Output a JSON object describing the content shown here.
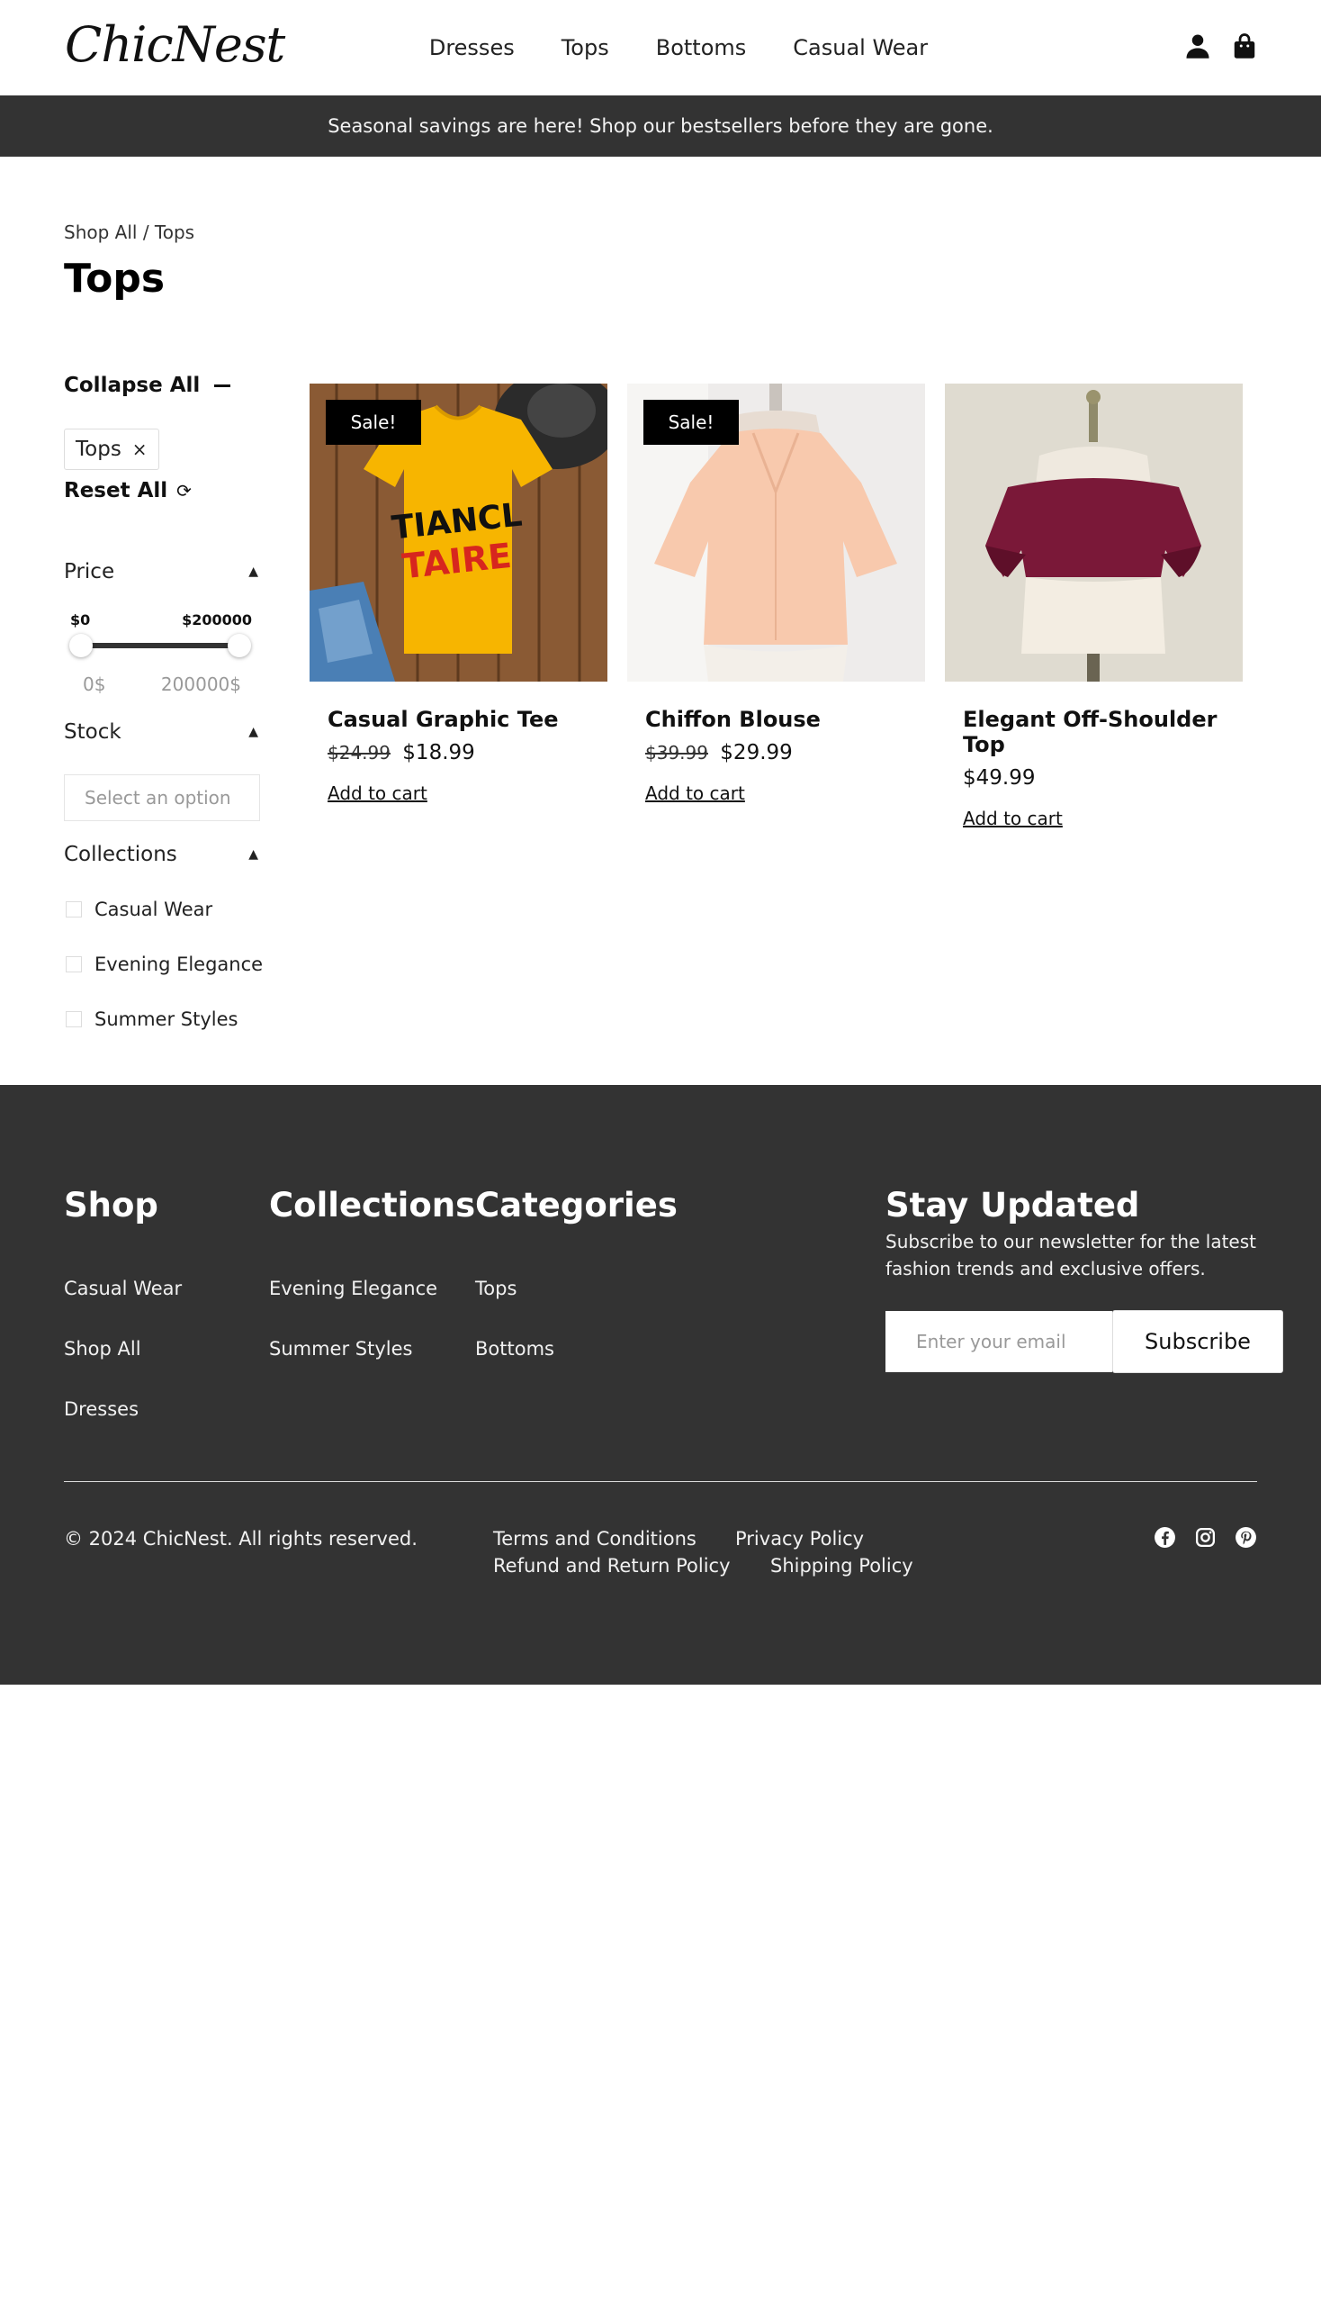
{
  "header": {
    "logo": "ChicNest",
    "nav": [
      "Dresses",
      "Tops",
      "Bottoms",
      "Casual Wear"
    ],
    "icons": [
      "user-icon",
      "shopping-bag-icon"
    ]
  },
  "banner": {
    "text": "Seasonal savings are here! Shop our bestsellers before they are gone."
  },
  "breadcrumb": "Shop All / Tops",
  "page_title": "Tops",
  "sidebar": {
    "collapse_all": "Collapse All",
    "active_filter": "Tops",
    "active_filter_remove": "×",
    "reset_all": "Reset All",
    "price": {
      "label": "Price",
      "min_label": "$0",
      "max_label": "$200000",
      "min_value": "0$",
      "max_value": "200000$"
    },
    "stock": {
      "label": "Stock",
      "placeholder": "Select an option"
    },
    "collections": {
      "label": "Collections",
      "items": [
        "Casual Wear",
        "Evening Elegance",
        "Summer Styles"
      ]
    }
  },
  "products": [
    {
      "name": "Casual Graphic Tee",
      "badge": "Sale!",
      "old_price": "$24.99",
      "price": "$18.99",
      "cta": "Add to cart",
      "tee_text_1": "TIANCL",
      "tee_text_2": "TAIRE"
    },
    {
      "name": "Chiffon Blouse",
      "badge": "Sale!",
      "old_price": "$39.99",
      "price": "$29.99",
      "cta": "Add to cart"
    },
    {
      "name": "Elegant Off-Shoulder Top",
      "badge": "",
      "old_price": "",
      "price": "$49.99",
      "cta": "Add to cart"
    }
  ],
  "footer": {
    "shop": {
      "title": "Shop",
      "links": [
        "Casual Wear",
        "Shop All",
        "Dresses"
      ]
    },
    "collections": {
      "title": "Collections",
      "links": [
        "Evening Elegance",
        "Summer Styles"
      ]
    },
    "categories": {
      "title": "Categories",
      "links": [
        "Tops",
        "Bottoms"
      ]
    },
    "newsletter": {
      "title": "Stay Updated",
      "text": "Subscribe to our newsletter for the latest fashion trends and exclusive offers.",
      "placeholder": "Enter your email",
      "button": "Subscribe"
    },
    "copyright": "© 2024 ChicNest. All rights reserved.",
    "legal": [
      "Terms and Conditions",
      "Privacy Policy",
      "Refund and Return Policy",
      "Shipping Policy"
    ],
    "social": [
      "facebook-icon",
      "instagram-icon",
      "pinterest-icon"
    ]
  }
}
